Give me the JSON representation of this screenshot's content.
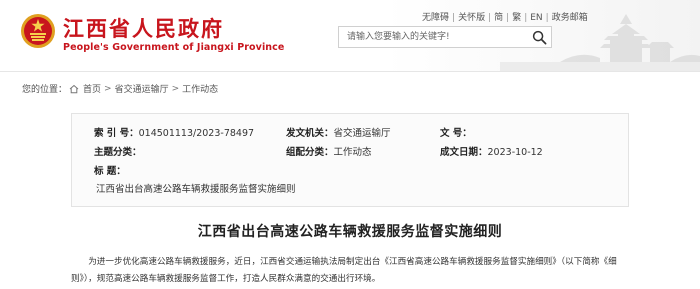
{
  "header": {
    "site_name_cn": "江西省人民政府",
    "site_name_en": "People's Government of Jiangxi Province",
    "top_links": [
      "无障碍",
      "关怀版",
      "简",
      "繁",
      "EN",
      "政务邮箱"
    ],
    "search": {
      "placeholder": "请输入您要输入的关键字!"
    }
  },
  "breadcrumb": {
    "prefix": "您的位置：",
    "items": [
      "首页",
      "省交通运输厅",
      "工作动态"
    ]
  },
  "meta": {
    "index_label": "索  引  号：",
    "index_value": "014501113/2023-78497",
    "issuer_label": "发文机关：",
    "issuer_value": "省交通运输厅",
    "doc_no_label": "文        号：",
    "doc_no_value": "",
    "topic_label": "主题分类：",
    "topic_value": "",
    "org_label": "组配分类：",
    "org_value": "工作动态",
    "date_label": "成文日期：",
    "date_value": "2023-10-12",
    "title_label": "标        题：",
    "title_value": "江西省出台高速公路车辆救援服务监督实施细则"
  },
  "article": {
    "title": "江西省出台高速公路车辆救援服务监督实施细则",
    "body": "为进一步优化高速公路车辆救援服务，近日，江西省交通运输执法局制定出台《江西省高速公路车辆救援服务监督实施细则》（以下简称《细则》），规范高速公路车辆救援服务监督工作，打造人民群众满意的交通出行环境。"
  }
}
